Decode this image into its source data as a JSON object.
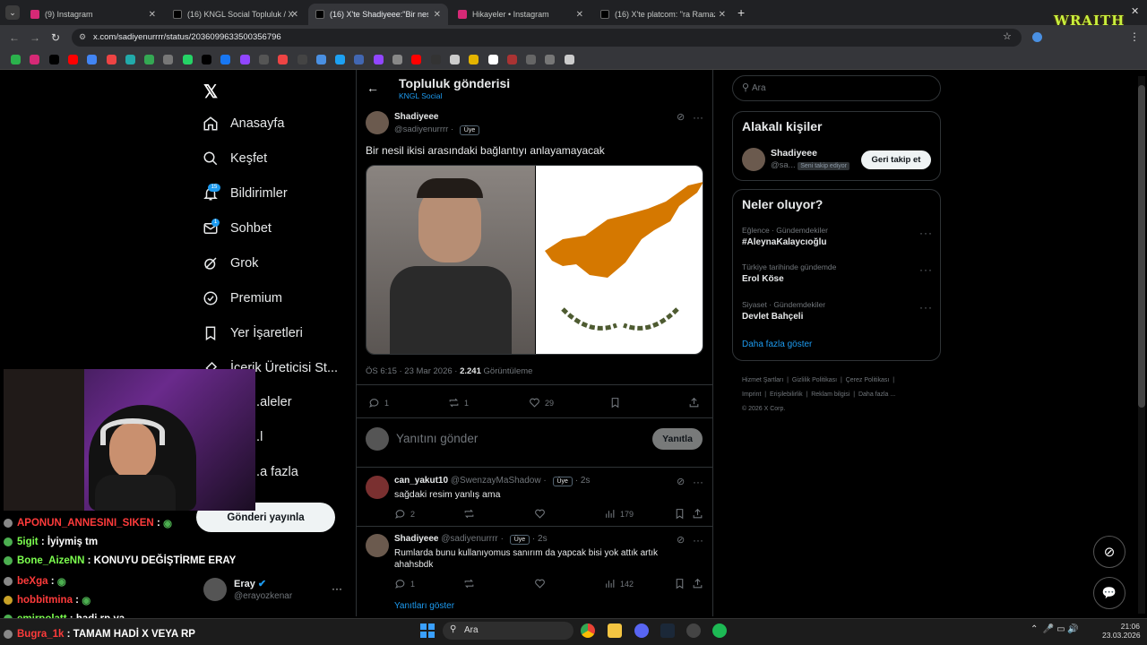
{
  "browser": {
    "tabs": [
      {
        "label": "(9) Instagram",
        "color": "#d62976"
      },
      {
        "label": "(16) KNGL Social Topluluk / X",
        "color": "#000000"
      },
      {
        "label": "(16) X'te Shadiyeee:\"Bir nesil i...",
        "color": "#000000"
      },
      {
        "label": "Hikayeler • Instagram",
        "color": "#d62976"
      },
      {
        "label": "(16) X'te platcom: \"ra Ramazan",
        "color": "#000000"
      }
    ],
    "url": "x.com/sadiyenurrrr/status/2036099633500356796"
  },
  "nav": {
    "items": [
      {
        "label": "Anasayfa"
      },
      {
        "label": "Keşfet"
      },
      {
        "label": "Bildirimler",
        "badge": "15"
      },
      {
        "label": "Sohbet",
        "badge": "1"
      },
      {
        "label": "Grok"
      },
      {
        "label": "Premium"
      },
      {
        "label": "Yer İşaretleri"
      },
      {
        "label": "İçerik Üreticisi St..."
      },
      {
        "label": "...aleler"
      },
      {
        "label": "...l"
      },
      {
        "label": "...a fazla"
      }
    ],
    "post_button": "Gönderi yayınla",
    "account": {
      "name": "Eray",
      "handle": "@erayozkenar"
    }
  },
  "header": {
    "title": "Topluluk gönderisi",
    "subtitle": "KNGL Social"
  },
  "post": {
    "author": "Shadiyeee",
    "handle": "@sadiyenurrrr",
    "badge": "Üye",
    "text": "Bir nesil ikisi arasındaki bağlantıyı anlayamayacak",
    "time": "ÖS 6:15 · 23 Mar 2026 ·",
    "views": "2.241",
    "views_label": "Görüntüleme",
    "replies": "1",
    "reposts": "1",
    "likes": "29"
  },
  "reply_box": {
    "placeholder": "Yanıtını gönder",
    "button": "Yanıtla"
  },
  "replies": [
    {
      "author": "can_yakut10",
      "handle": "@SwenzayMaShadow",
      "badge": "Üye",
      "time": "· 2s",
      "text": "sağdaki resim yanlış ama",
      "replies": "2",
      "views": "179"
    },
    {
      "author": "Shadiyeee",
      "handle": "@sadiyenurrrr",
      "badge": "Üye",
      "time": "· 2s",
      "text": "Rumlarda bunu kullanıyomus sanırım da yapcak bisi yok attık artık ahahsbdk",
      "replies": "1",
      "views": "142"
    }
  ],
  "show_replies": "Yanıtları göster",
  "search": {
    "placeholder": "Ara"
  },
  "related": {
    "title": "Alakalı kişiler",
    "name": "Shadiyeee",
    "handle": "@sa...",
    "follows_you": "Seni takip ediyor",
    "button": "Geri takip et"
  },
  "trends": {
    "title": "Neler oluyor?",
    "items": [
      {
        "category": "Eğlence · Gündemdekiler",
        "name": "#AleynaKalaycıoğlu"
      },
      {
        "category": "Türkiye tarihinde gündemde",
        "name": "Erol Köse"
      },
      {
        "category": "Siyaset · Gündemdekiler",
        "name": "Devlet Bahçeli"
      }
    ],
    "more": "Daha fazla göster"
  },
  "footer": {
    "line1": [
      "Hizmet Şartları",
      "Gizlilik Politikası",
      "Çerez Politikası"
    ],
    "line2": [
      "Imprint",
      "Erişilebilirlik",
      "Reklam bilgisi",
      "Daha fazla ..."
    ],
    "copyright": "© 2026 X Corp."
  },
  "chat": [
    {
      "user": "APONUN_ANNESINI_SIKEN",
      "msg": ":",
      "color": "#ff3b3b"
    },
    {
      "user": "5igit",
      "msg": ": İyiymiş tm",
      "color": "#7cff4f"
    },
    {
      "user": "Bone_AizeNN",
      "msg": ": KONUYU DEĞİŞTİRME ERAY",
      "color": "#7cff4f"
    },
    {
      "user": "beXga",
      "msg": ":",
      "color": "#ff3b3b"
    },
    {
      "user": "hobbitmina",
      "msg": ":",
      "color": "#ff3b3b"
    },
    {
      "user": "emirpolatt",
      "msg": ": hadi rp ya",
      "color": "#7cff4f"
    },
    {
      "user": "Bugra_1k",
      "msg": ": TAMAM HADİ X VEYA RP",
      "color": "#ff3b3b"
    }
  ],
  "taskbar": {
    "search": "Ara",
    "time": "21:06",
    "date": "23.03.2026"
  },
  "overlay": {
    "logo": "WRAITH"
  }
}
